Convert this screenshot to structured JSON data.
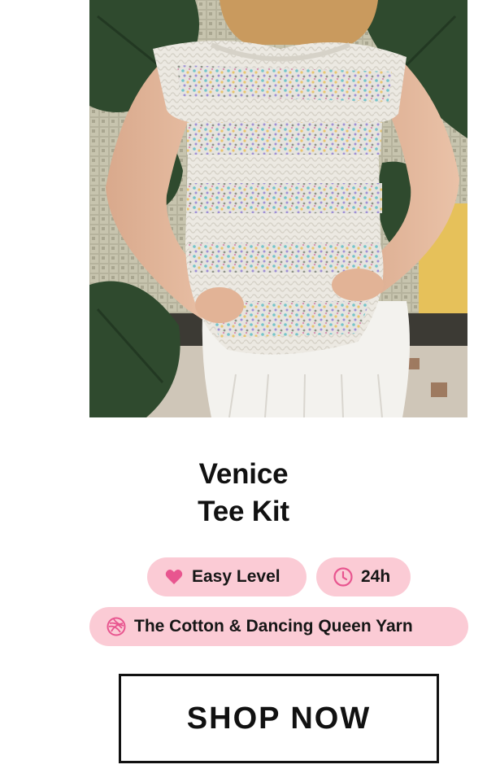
{
  "product": {
    "image_alt": "Woman wearing a white knit sequin tee with a white pleated skirt in front of monstera leaves",
    "title_line1": "Venice",
    "title_line2": "Tee Kit"
  },
  "badges": {
    "level": {
      "icon": "heart-icon",
      "label": "Easy Level"
    },
    "time": {
      "icon": "clock-icon",
      "label": "24h"
    },
    "yarn": {
      "icon": "yarn-ball-icon",
      "label": "The Cotton & Dancing Queen Yarn"
    }
  },
  "cta": {
    "label": "SHOP NOW"
  },
  "colors": {
    "badge_bg": "#fbcbd5",
    "icon_pink": "#e8558f",
    "text": "#111111",
    "button_border": "#111111"
  }
}
